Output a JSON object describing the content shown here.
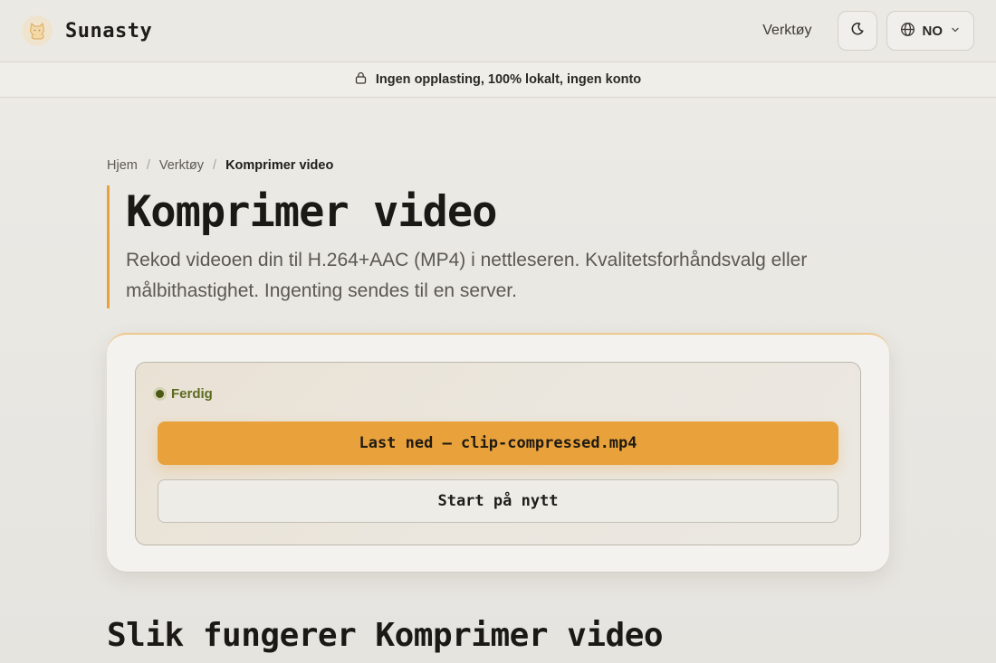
{
  "header": {
    "brand": "Sunasty",
    "nav_tools": "Verktøy",
    "language": "NO",
    "icons": {
      "logo": "cat-logo-icon",
      "theme": "moon-icon",
      "globe": "globe-icon",
      "chevron": "chevron-down-icon"
    }
  },
  "banner": {
    "icon": "lock-icon",
    "text": "Ingen opplasting, 100% lokalt, ingen konto"
  },
  "breadcrumb": {
    "home": "Hjem",
    "sep1": "/",
    "tools": "Verktøy",
    "sep2": "/",
    "current": "Komprimer video"
  },
  "hero": {
    "title": "Komprimer video",
    "subtitle": "Rekod videoen din til H.264+AAC (MP4) i nettleseren. Kvalitetsforhåndsvalg eller målbithastighet. Ingenting sendes til en server."
  },
  "result": {
    "status": "Ferdig",
    "download_label": "Last ned — clip-compressed.mp4",
    "restart_label": "Start på nytt"
  },
  "section": {
    "title": "Slik fungerer Komprimer video"
  },
  "colors": {
    "accent": "#e9a23b",
    "status_green": "#5c6b1f",
    "background": "#e8e6e1"
  }
}
